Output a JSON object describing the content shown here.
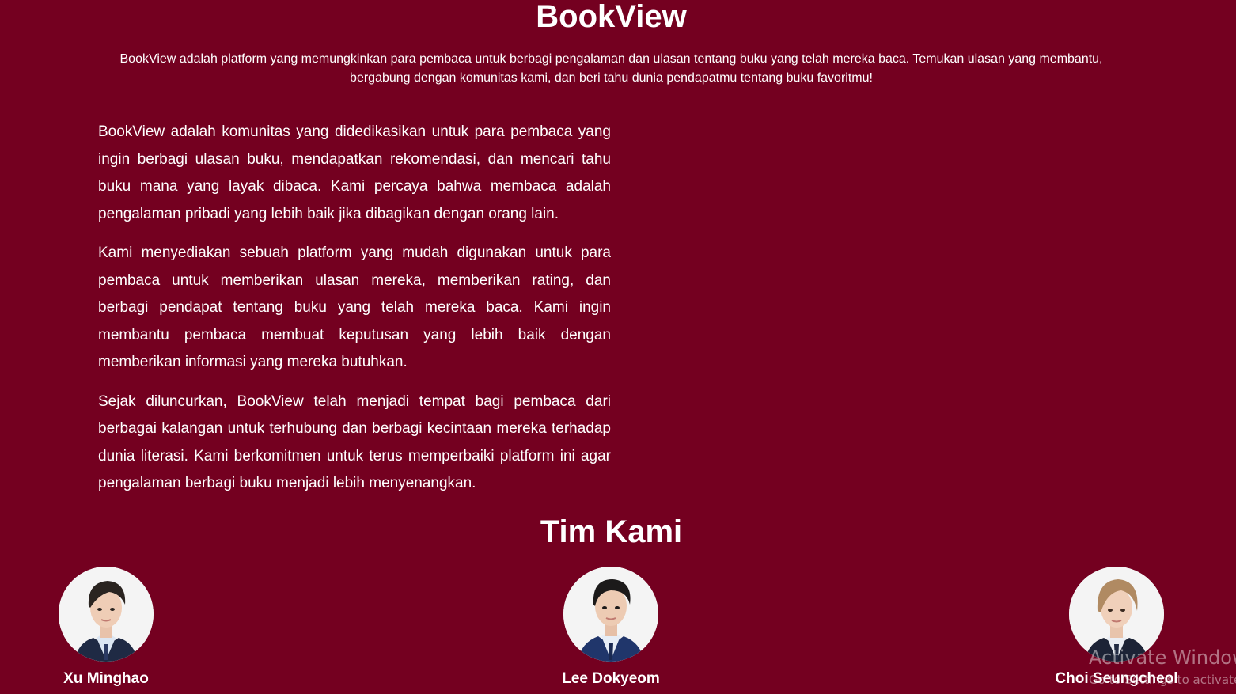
{
  "hero": {
    "title": "BookView",
    "subtitle": "BookView adalah platform yang memungkinkan para pembaca untuk berbagi pengalaman dan ulasan tentang buku yang telah mereka baca. Temukan ulasan yang membantu, bergabung dengan komunitas kami, dan beri tahu dunia pendapatmu tentang buku favoritmu!"
  },
  "about": {
    "paragraphs": [
      "BookView adalah komunitas yang didedikasikan untuk para pembaca yang ingin berbagi ulasan buku, mendapatkan rekomendasi, dan mencari tahu buku mana yang layak dibaca. Kami percaya bahwa membaca adalah pengalaman pribadi yang lebih baik jika dibagikan dengan orang lain.",
      "Kami menyediakan sebuah platform yang mudah digunakan untuk para pembaca untuk memberikan ulasan mereka, memberikan rating, dan berbagi pendapat tentang buku yang telah mereka baca. Kami ingin membantu pembaca membuat keputusan yang lebih baik dengan memberikan informasi yang mereka butuhkan.",
      "Sejak diluncurkan, BookView telah menjadi tempat bagi pembaca dari berbagai kalangan untuk terhubung dan berbagi kecintaan mereka terhadap dunia literasi. Kami berkomitmen untuk terus memperbaiki platform ini agar pengalaman berbagi buku menjadi lebih menyenangkan."
    ]
  },
  "team": {
    "title": "Tim Kami",
    "members": [
      {
        "name": "Xu Minghao"
      },
      {
        "name": "Lee Dokyeom"
      },
      {
        "name": "Choi Seungcheol"
      }
    ]
  },
  "watermark": {
    "line1": "Activate Windows",
    "line2": "Go to Settings to activate Windows."
  },
  "colors": {
    "background": "#740020",
    "text": "#ffffff"
  }
}
